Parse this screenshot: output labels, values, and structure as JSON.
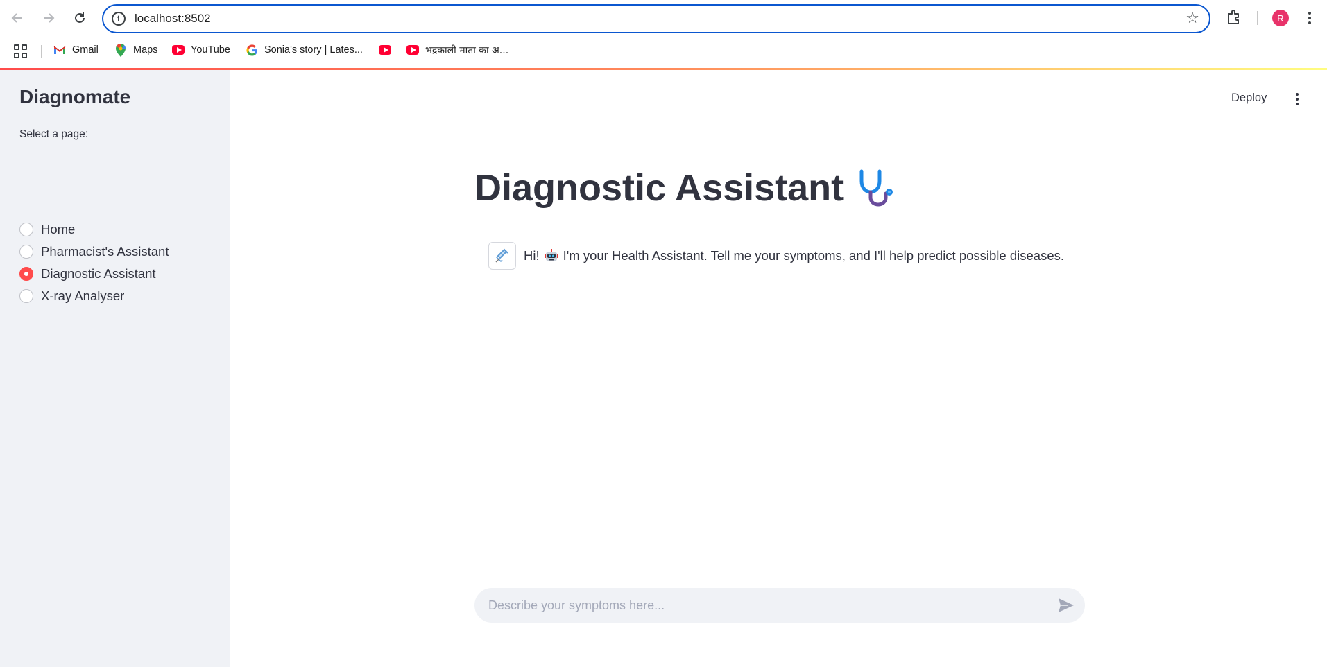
{
  "browser": {
    "url": "localhost:8502",
    "profile_initial": "R",
    "bookmarks": [
      {
        "label": "Gmail",
        "icon": "gmail-icon"
      },
      {
        "label": "Maps",
        "icon": "maps-icon"
      },
      {
        "label": "YouTube",
        "icon": "youtube-icon"
      },
      {
        "label": "Sonia's story | Lates...",
        "icon": "google-icon"
      },
      {
        "label": "",
        "icon": "youtube-icon"
      },
      {
        "label": "भद्रकाली माता का अ...",
        "icon": "youtube-icon"
      }
    ]
  },
  "sidebar": {
    "title": "Diagnomate",
    "select_label": "Select a page:",
    "options": [
      "Home",
      "Pharmacist's Assistant",
      "Diagnostic Assistant",
      "X-ray Analyser"
    ],
    "selected": "Diagnostic Assistant"
  },
  "header": {
    "deploy_label": "Deploy"
  },
  "main": {
    "title": "Diagnostic Assistant",
    "title_icon": "stethoscope-icon",
    "message": {
      "avatar_icon": "syringe-icon",
      "greeting": "Hi!",
      "emoji": "robot-icon",
      "text": "I'm your Health Assistant. Tell me your symptoms, and I'll help predict possible diseases."
    },
    "chat_input": {
      "placeholder": "Describe your symptoms here...",
      "value": ""
    }
  },
  "colors": {
    "accent": "#ff4b4b",
    "sidebar_bg": "#f0f2f6",
    "omnibox_border": "#0b57d0"
  }
}
